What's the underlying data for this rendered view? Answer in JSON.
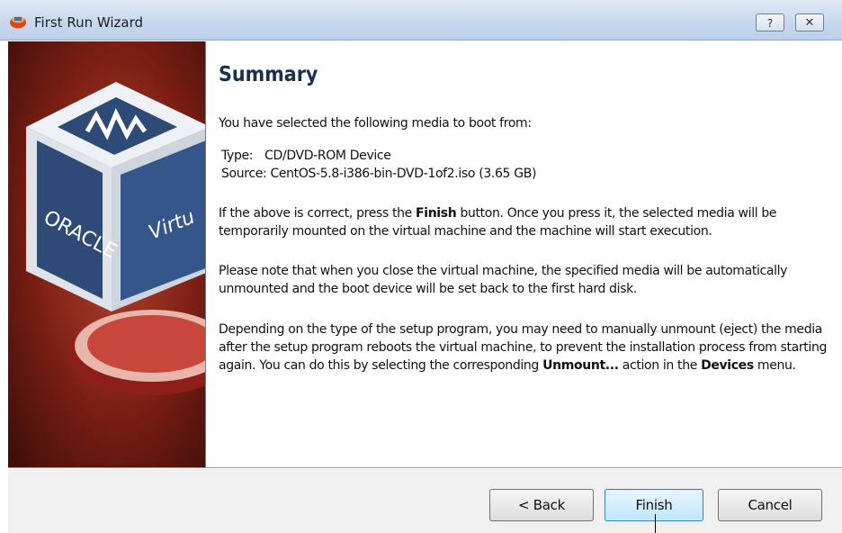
{
  "window": {
    "title": "First Run Wizard",
    "help_label": "?",
    "close_label": "✕"
  },
  "banner": {
    "logo_text_left": "ORACLE",
    "logo_text_right": "Virtu"
  },
  "content": {
    "heading": "Summary",
    "intro": "You have selected the following media to boot from:",
    "media": {
      "type_label": "Type:",
      "type_value": "CD/DVD-ROM Device",
      "source_label": "Source:",
      "source_value": "CentOS-5.8-i386-bin-DVD-1of2.iso (3.65 GB)"
    },
    "p1": {
      "a": "If the above is correct, press the ",
      "b": "Finish",
      "c": " button. Once you press it, the selected media will be temporarily mounted on the virtual machine and the machine will start execution."
    },
    "p2": "Please note that when you close the virtual machine, the specified media will be automatically unmounted and the boot device will be set back to the first hard disk.",
    "p3": {
      "a": "Depending on the type of the setup program, you may need to manually unmount (eject) the media after the setup program reboots the virtual machine, to prevent the installation process from starting again. You can do this by selecting the corresponding ",
      "b": "Unmount...",
      "c": " action in the ",
      "d": "Devices",
      "e": " menu."
    }
  },
  "buttons": {
    "back": "< Back",
    "finish": "Finish",
    "cancel": "Cancel"
  },
  "colors": {
    "heading": "#1b2f4f",
    "finish_border": "#3c7fb1",
    "banner": "#7a1e13"
  }
}
